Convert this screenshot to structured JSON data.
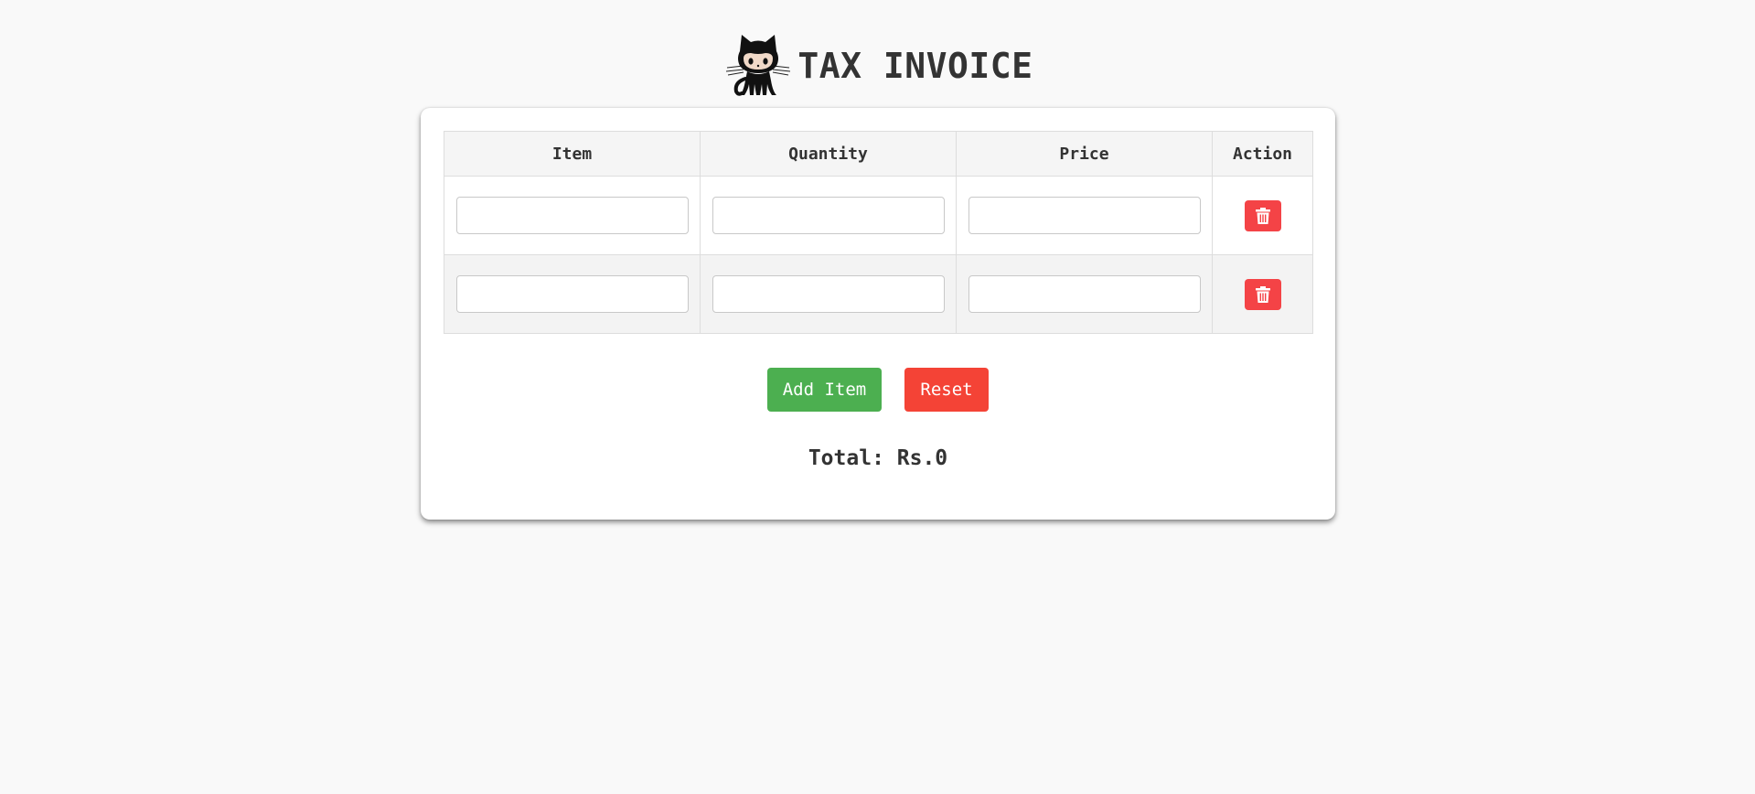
{
  "header": {
    "title": "TAX INVOICE",
    "logo_icon": "octocat-icon"
  },
  "table": {
    "columns": [
      "Item",
      "Quantity",
      "Price",
      "Action"
    ],
    "rows": [
      {
        "item": "",
        "quantity": "",
        "price": ""
      },
      {
        "item": "",
        "quantity": "",
        "price": ""
      }
    ],
    "delete_icon": "trash-icon"
  },
  "buttons": {
    "add_label": "Add Item",
    "reset_label": "Reset"
  },
  "total": {
    "text": "Total: Rs.0"
  },
  "colors": {
    "background": "#f9f9f9",
    "add_button": "#4caf50",
    "reset_button": "#f44336",
    "delete_button": "#f44346",
    "text": "#333333"
  }
}
